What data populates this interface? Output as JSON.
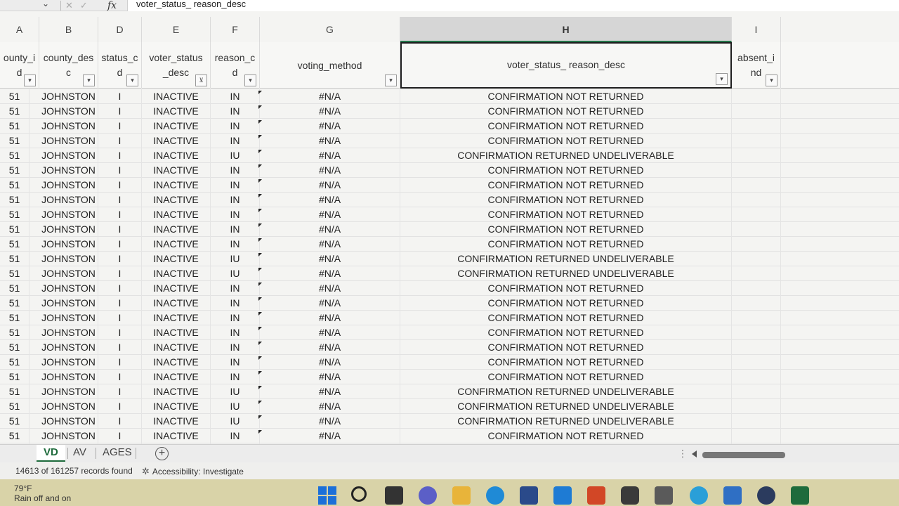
{
  "formula_bar": {
    "fx_label": "fx",
    "content": "voter_status_ reason_desc"
  },
  "columns": [
    {
      "letter": "A",
      "header": "county_i d",
      "h1": "ounty_i",
      "h2": "d"
    },
    {
      "letter": "B",
      "header": "county_des c",
      "h1": "county_des",
      "h2": "c"
    },
    {
      "letter": "D",
      "header": "status_c d",
      "h1": "status_c",
      "h2": "d"
    },
    {
      "letter": "E",
      "header": "voter_status _desc",
      "h1": "voter_status",
      "h2": "_desc"
    },
    {
      "letter": "F",
      "header": "reason_c d",
      "h1": "reason_c",
      "h2": "d"
    },
    {
      "letter": "G",
      "header": "voting_method",
      "h1": "voting_method",
      "h2": ""
    },
    {
      "letter": "H",
      "header": "voter_status_ reason_desc",
      "h1": "voter_status_ reason_desc",
      "h2": ""
    },
    {
      "letter": "I",
      "header": "absent_i nd",
      "h1": "absent_i",
      "h2": "nd"
    }
  ],
  "rows": [
    [
      "51",
      "JOHNSTON",
      "I",
      "INACTIVE",
      "IN",
      "#N/A",
      "CONFIRMATION NOT RETURNED"
    ],
    [
      "51",
      "JOHNSTON",
      "I",
      "INACTIVE",
      "IN",
      "#N/A",
      "CONFIRMATION NOT RETURNED"
    ],
    [
      "51",
      "JOHNSTON",
      "I",
      "INACTIVE",
      "IN",
      "#N/A",
      "CONFIRMATION NOT RETURNED"
    ],
    [
      "51",
      "JOHNSTON",
      "I",
      "INACTIVE",
      "IN",
      "#N/A",
      "CONFIRMATION NOT RETURNED"
    ],
    [
      "51",
      "JOHNSTON",
      "I",
      "INACTIVE",
      "IU",
      "#N/A",
      "CONFIRMATION RETURNED UNDELIVERABLE"
    ],
    [
      "51",
      "JOHNSTON",
      "I",
      "INACTIVE",
      "IN",
      "#N/A",
      "CONFIRMATION NOT RETURNED"
    ],
    [
      "51",
      "JOHNSTON",
      "I",
      "INACTIVE",
      "IN",
      "#N/A",
      "CONFIRMATION NOT RETURNED"
    ],
    [
      "51",
      "JOHNSTON",
      "I",
      "INACTIVE",
      "IN",
      "#N/A",
      "CONFIRMATION NOT RETURNED"
    ],
    [
      "51",
      "JOHNSTON",
      "I",
      "INACTIVE",
      "IN",
      "#N/A",
      "CONFIRMATION NOT RETURNED"
    ],
    [
      "51",
      "JOHNSTON",
      "I",
      "INACTIVE",
      "IN",
      "#N/A",
      "CONFIRMATION NOT RETURNED"
    ],
    [
      "51",
      "JOHNSTON",
      "I",
      "INACTIVE",
      "IN",
      "#N/A",
      "CONFIRMATION NOT RETURNED"
    ],
    [
      "51",
      "JOHNSTON",
      "I",
      "INACTIVE",
      "IU",
      "#N/A",
      "CONFIRMATION RETURNED UNDELIVERABLE"
    ],
    [
      "51",
      "JOHNSTON",
      "I",
      "INACTIVE",
      "IU",
      "#N/A",
      "CONFIRMATION RETURNED UNDELIVERABLE"
    ],
    [
      "51",
      "JOHNSTON",
      "I",
      "INACTIVE",
      "IN",
      "#N/A",
      "CONFIRMATION NOT RETURNED"
    ],
    [
      "51",
      "JOHNSTON",
      "I",
      "INACTIVE",
      "IN",
      "#N/A",
      "CONFIRMATION NOT RETURNED"
    ],
    [
      "51",
      "JOHNSTON",
      "I",
      "INACTIVE",
      "IN",
      "#N/A",
      "CONFIRMATION NOT RETURNED"
    ],
    [
      "51",
      "JOHNSTON",
      "I",
      "INACTIVE",
      "IN",
      "#N/A",
      "CONFIRMATION NOT RETURNED"
    ],
    [
      "51",
      "JOHNSTON",
      "I",
      "INACTIVE",
      "IN",
      "#N/A",
      "CONFIRMATION NOT RETURNED"
    ],
    [
      "51",
      "JOHNSTON",
      "I",
      "INACTIVE",
      "IN",
      "#N/A",
      "CONFIRMATION NOT RETURNED"
    ],
    [
      "51",
      "JOHNSTON",
      "I",
      "INACTIVE",
      "IN",
      "#N/A",
      "CONFIRMATION NOT RETURNED"
    ],
    [
      "51",
      "JOHNSTON",
      "I",
      "INACTIVE",
      "IU",
      "#N/A",
      "CONFIRMATION RETURNED UNDELIVERABLE"
    ],
    [
      "51",
      "JOHNSTON",
      "I",
      "INACTIVE",
      "IU",
      "#N/A",
      "CONFIRMATION RETURNED UNDELIVERABLE"
    ],
    [
      "51",
      "JOHNSTON",
      "I",
      "INACTIVE",
      "IU",
      "#N/A",
      "CONFIRMATION RETURNED UNDELIVERABLE"
    ],
    [
      "51",
      "JOHNSTON",
      "I",
      "INACTIVE",
      "IN",
      "#N/A",
      "CONFIRMATION NOT RETURNED"
    ],
    [
      "51",
      "JOHNSTON",
      "I",
      "INACTIVE",
      "IN",
      "#N/A",
      "CONFIRMATION NOT RETURNED"
    ]
  ],
  "sheet_tabs": {
    "active": "VD",
    "second": "AV",
    "third": "AGES",
    "add_icon": "plus-circle-icon"
  },
  "status_bar": {
    "records": "14613 of 161257 records found",
    "accessibility": "Accessibility: Investigate"
  },
  "taskbar": {
    "temperature": "79°F",
    "weather": "Rain off and on"
  },
  "colors": {
    "excel_green": "#1e6b3c",
    "taskbar": "#d9d3a8"
  }
}
